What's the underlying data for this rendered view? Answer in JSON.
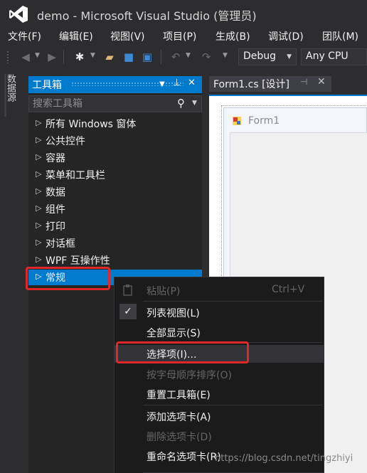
{
  "window": {
    "title": "demo - Microsoft Visual Studio (管理员)"
  },
  "menu": [
    "文件(F)",
    "编辑(E)",
    "视图(V)",
    "项目(P)",
    "生成(B)",
    "调试(D)",
    "团队(M)"
  ],
  "toolbar": {
    "config": "Debug",
    "platform": "Any CPU"
  },
  "left_strip": {
    "label": "数据源"
  },
  "toolbox": {
    "title": "工具箱",
    "search_placeholder": "搜索工具箱",
    "items": [
      "所有 Windows 窗体",
      "公共控件",
      "容器",
      "菜单和工具栏",
      "数据",
      "组件",
      "打印",
      "对话框",
      "WPF 互操作性",
      "常规"
    ],
    "selected": "常规"
  },
  "document": {
    "tab": "Form1.cs [设计]",
    "form_title": "Form1"
  },
  "context_menu": {
    "paste": {
      "label": "粘贴(P)",
      "shortcut": "Ctrl+V",
      "enabled": false
    },
    "list_view": {
      "label": "列表视图(L)",
      "checked": true
    },
    "show_all": {
      "label": "全部显示(S)"
    },
    "choose_items": {
      "label": "选择项(I)..."
    },
    "sort_alpha": {
      "label": "按字母顺序排序(O)",
      "enabled": false
    },
    "reset_toolbox": {
      "label": "重置工具箱(E)"
    },
    "add_tab": {
      "label": "添加选项卡(A)"
    },
    "delete_tab": {
      "label": "删除选项卡(D)",
      "enabled": false
    },
    "rename_tab": {
      "label": "重命名选项卡(R)"
    }
  },
  "watermark": "https://blog.csdn.net/tingzhiyi",
  "colors": {
    "accent": "#007acc",
    "highlight": "#e0282a",
    "background": "#2d2d30",
    "menu_bg": "#1b1b1c"
  }
}
